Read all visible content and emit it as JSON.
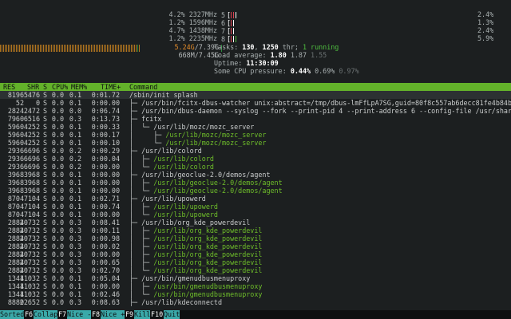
{
  "cpu_left": [
    {
      "pct": "4.2%",
      "freq": "2327MHz"
    },
    {
      "pct": "1.2%",
      "freq": "1596MHz"
    },
    {
      "pct": "4.7%",
      "freq": "1438MHz"
    },
    {
      "pct": "1.2%",
      "freq": "2235MHz"
    }
  ],
  "cpu_mini": [
    {
      "num": "5",
      "open": "["
    },
    {
      "num": "6",
      "open": "["
    },
    {
      "num": "7",
      "open": "["
    },
    {
      "num": "8",
      "open": "["
    }
  ],
  "cpu_right": [
    "2.4%",
    "1.3%",
    "2.4%",
    "5.9%"
  ],
  "mem": {
    "used": "5.24G",
    "total": "/7.39G"
  },
  "swap": {
    "text": "668M/7.45G"
  },
  "stats": {
    "tasks_label": "Tasks: ",
    "tasks": "130",
    "thr": "1250",
    "thr_label": " thr; ",
    "running": "1 running",
    "load_label": "Load average: ",
    "load1": "1.80",
    "load5": "1.87",
    "load15": "1.55",
    "uptime_label": "Uptime: ",
    "uptime": "11:30:09",
    "pressure_label": "Some CPU pressure: ",
    "p1": "0.44%",
    "p2": "0.69%",
    "p3": "0.97%"
  },
  "columns": {
    "res": "RES",
    "shr": "SHR",
    "s": "S",
    "cpu": "CPU%",
    "mem": "MEM%",
    "time": "TIME+",
    "command": "Command"
  },
  "rows": [
    {
      "res": "8196",
      "shr": "5476",
      "s": "S",
      "cpu": "0.0",
      "mem": "0.1",
      "time": "0:01.72",
      "tree": "",
      "cmd": "/sbin/init splash",
      "kind": "cmd"
    },
    {
      "res": "52",
      "shr": "0",
      "s": "S",
      "cpu": "0.0",
      "mem": "0.1",
      "time": "0:00.00",
      "tree": "├─ ",
      "cmd": "/usr/bin/fcitx-dbus-watcher unix:abstract=/tmp/dbus-lmFfLpA7SG,guid=80f8c557ab6decc81fe4b84b",
      "kind": "cmd"
    },
    {
      "res": "2824",
      "shr": "2472",
      "s": "S",
      "cpu": "0.0",
      "mem": "0.0",
      "time": "0:06.74",
      "tree": "├─ ",
      "cmd": "/usr/bin/dbus-daemon --syslog --fork --print-pid 4 --print-address 6 --config-file /usr/shar",
      "kind": "cmd"
    },
    {
      "res": "7960",
      "shr": "6516",
      "s": "S",
      "cpu": "0.0",
      "mem": "0.3",
      "time": "0:13.73",
      "tree": "├─ ",
      "cmd": "fcitx",
      "kind": "cmd"
    },
    {
      "res": "5960",
      "shr": "4252",
      "s": "S",
      "cpu": "0.0",
      "mem": "0.1",
      "time": "0:00.33",
      "tree": "│  └─ ",
      "cmd": "/usr/lib/mozc/mozc_server",
      "kind": "cmd"
    },
    {
      "res": "5960",
      "shr": "4252",
      "s": "S",
      "cpu": "0.0",
      "mem": "0.1",
      "time": "0:00.17",
      "tree": "│     ├─ ",
      "cmd": "/usr/lib/mozc/mozc_server",
      "kind": "thread"
    },
    {
      "res": "5960",
      "shr": "4252",
      "s": "S",
      "cpu": "0.0",
      "mem": "0.1",
      "time": "0:00.10",
      "tree": "│     └─ ",
      "cmd": "/usr/lib/mozc/mozc_server",
      "kind": "thread"
    },
    {
      "res": "2936",
      "shr": "6696",
      "s": "S",
      "cpu": "0.0",
      "mem": "0.2",
      "time": "0:00.29",
      "tree": "├─ ",
      "cmd": "/usr/lib/colord",
      "kind": "cmd"
    },
    {
      "res": "2936",
      "shr": "6696",
      "s": "S",
      "cpu": "0.0",
      "mem": "0.2",
      "time": "0:00.04",
      "tree": "│  ├─ ",
      "cmd": "/usr/lib/colord",
      "kind": "thread"
    },
    {
      "res": "2936",
      "shr": "6696",
      "s": "S",
      "cpu": "0.0",
      "mem": "0.2",
      "time": "0:00.00",
      "tree": "│  └─ ",
      "cmd": "/usr/lib/colord",
      "kind": "thread"
    },
    {
      "res": "3968",
      "shr": "3968",
      "s": "S",
      "cpu": "0.0",
      "mem": "0.1",
      "time": "0:00.00",
      "tree": "├─ ",
      "cmd": "/usr/lib/geoclue-2.0/demos/agent",
      "kind": "cmd"
    },
    {
      "res": "3968",
      "shr": "3968",
      "s": "S",
      "cpu": "0.0",
      "mem": "0.1",
      "time": "0:00.00",
      "tree": "│  ├─ ",
      "cmd": "/usr/lib/geoclue-2.0/demos/agent",
      "kind": "thread"
    },
    {
      "res": "3968",
      "shr": "3968",
      "s": "S",
      "cpu": "0.0",
      "mem": "0.1",
      "time": "0:00.00",
      "tree": "│  └─ ",
      "cmd": "/usr/lib/geoclue-2.0/demos/agent",
      "kind": "thread"
    },
    {
      "res": "8704",
      "shr": "7104",
      "s": "S",
      "cpu": "0.0",
      "mem": "0.1",
      "time": "0:02.71",
      "tree": "├─ ",
      "cmd": "/usr/lib/upowerd",
      "kind": "cmd"
    },
    {
      "res": "8704",
      "shr": "7104",
      "s": "S",
      "cpu": "0.0",
      "mem": "0.1",
      "time": "0:00.74",
      "tree": "│  ├─ ",
      "cmd": "/usr/lib/upowerd",
      "kind": "thread"
    },
    {
      "res": "8704",
      "shr": "7104",
      "s": "S",
      "cpu": "0.0",
      "mem": "0.1",
      "time": "0:00.00",
      "tree": "│  └─ ",
      "cmd": "/usr/lib/upowerd",
      "kind": "thread"
    },
    {
      "res": "2884",
      "shr": "20732",
      "s": "S",
      "cpu": "0.0",
      "mem": "0.3",
      "time": "0:08.41",
      "tree": "├─ ",
      "cmd": "/usr/lib/org_kde_powerdevil",
      "kind": "cmd"
    },
    {
      "res": "2884",
      "shr": "20732",
      "s": "S",
      "cpu": "0.0",
      "mem": "0.3",
      "time": "0:00.11",
      "tree": "│  ├─ ",
      "cmd": "/usr/lib/org_kde_powerdevil",
      "kind": "thread"
    },
    {
      "res": "2884",
      "shr": "20732",
      "s": "S",
      "cpu": "0.0",
      "mem": "0.3",
      "time": "0:00.98",
      "tree": "│  ├─ ",
      "cmd": "/usr/lib/org_kde_powerdevil",
      "kind": "thread"
    },
    {
      "res": "2884",
      "shr": "20732",
      "s": "S",
      "cpu": "0.0",
      "mem": "0.3",
      "time": "0:00.02",
      "tree": "│  ├─ ",
      "cmd": "/usr/lib/org_kde_powerdevil",
      "kind": "thread"
    },
    {
      "res": "2884",
      "shr": "20732",
      "s": "S",
      "cpu": "0.0",
      "mem": "0.3",
      "time": "0:00.00",
      "tree": "│  ├─ ",
      "cmd": "/usr/lib/org_kde_powerdevil",
      "kind": "thread"
    },
    {
      "res": "2884",
      "shr": "20732",
      "s": "S",
      "cpu": "0.0",
      "mem": "0.3",
      "time": "0:00.65",
      "tree": "│  ├─ ",
      "cmd": "/usr/lib/org_kde_powerdevil",
      "kind": "thread"
    },
    {
      "res": "2884",
      "shr": "20732",
      "s": "S",
      "cpu": "0.0",
      "mem": "0.3",
      "time": "0:02.70",
      "tree": "│  └─ ",
      "cmd": "/usr/lib/org_kde_powerdevil",
      "kind": "thread"
    },
    {
      "res": "1344",
      "shr": "11032",
      "s": "S",
      "cpu": "0.0",
      "mem": "0.1",
      "time": "0:05.04",
      "tree": "├─ ",
      "cmd": "/usr/bin/gmenudbusmenuproxy",
      "kind": "cmd"
    },
    {
      "res": "1344",
      "shr": "11032",
      "s": "S",
      "cpu": "0.0",
      "mem": "0.1",
      "time": "0:00.00",
      "tree": "│  ├─ ",
      "cmd": "/usr/bin/gmenudbusmenuproxy",
      "kind": "thread"
    },
    {
      "res": "1344",
      "shr": "11032",
      "s": "S",
      "cpu": "0.0",
      "mem": "0.1",
      "time": "0:02.46",
      "tree": "│  └─ ",
      "cmd": "/usr/bin/gmenudbusmenuproxy",
      "kind": "thread"
    },
    {
      "res": "8880",
      "shr": "22652",
      "s": "S",
      "cpu": "0.0",
      "mem": "0.3",
      "time": "0:08.63",
      "tree": "├─ ",
      "cmd": "/usr/lib/kdeconnectd",
      "kind": "cmd"
    }
  ],
  "footer": [
    {
      "key": "",
      "label": "Sorted"
    },
    {
      "key": "F6",
      "label": "Collap"
    },
    {
      "key": "F7",
      "label": "Nice -"
    },
    {
      "key": "F8",
      "label": "Nice +"
    },
    {
      "key": "F9",
      "label": "Kill"
    },
    {
      "key": "F10",
      "label": "Quit"
    }
  ]
}
